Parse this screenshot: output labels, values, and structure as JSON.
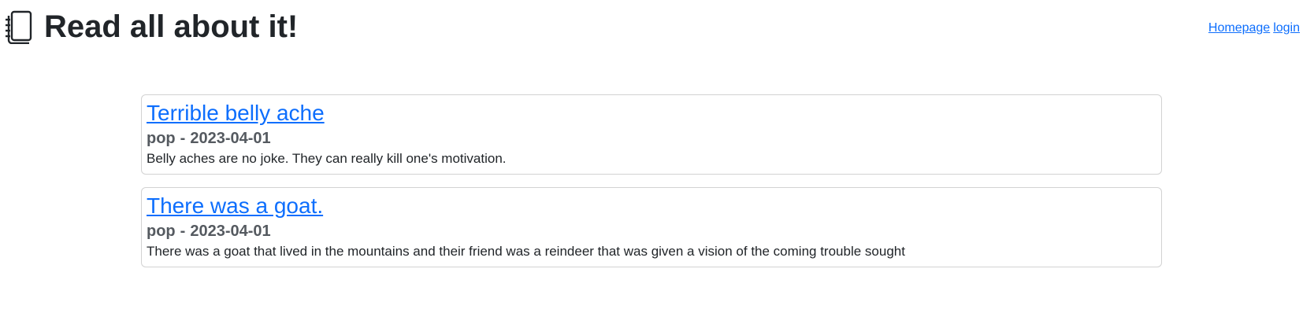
{
  "header": {
    "title": "Read all about it!",
    "icon": "journal-icon",
    "nav": {
      "homepage_label": "Homepage",
      "login_label": "login"
    }
  },
  "posts": [
    {
      "title": "Terrible belly ache",
      "category": "pop",
      "separator": "-",
      "date": "2023-04-01",
      "body": "Belly aches are no joke. They can really kill one's motivation."
    },
    {
      "title": "There was a goat.",
      "category": "pop",
      "separator": "-",
      "date": "2023-04-01",
      "body": "There was a goat that lived in the mountains and their friend was a reindeer that was given a vision of the coming trouble sought"
    }
  ],
  "colors": {
    "link": "#0d6efd",
    "text": "#212529",
    "meta": "#555a60",
    "border": "#d9d9d9"
  }
}
